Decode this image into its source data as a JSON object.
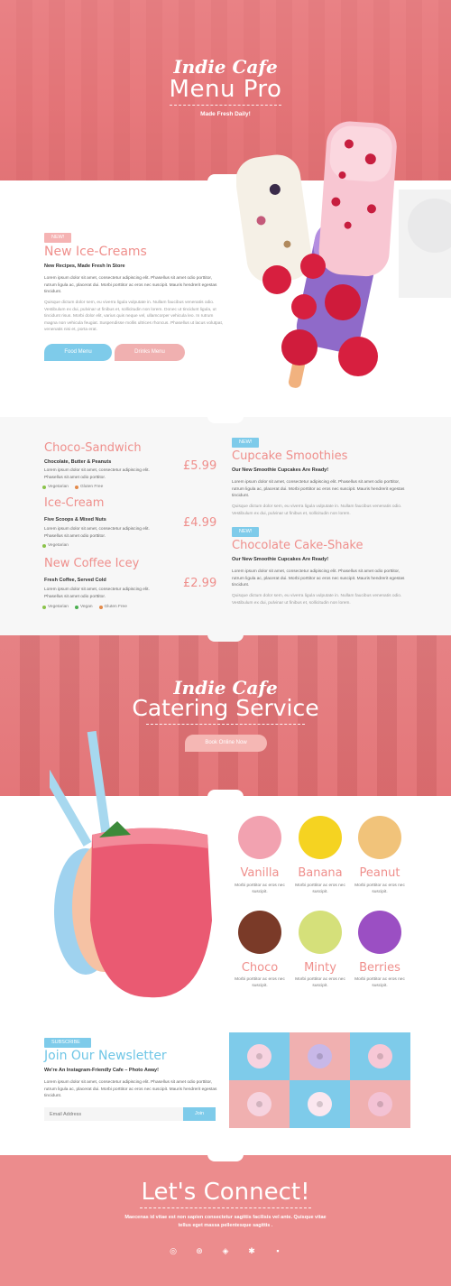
{
  "hero": {
    "script_title": "Indie Cafe",
    "title": "Menu Pro",
    "tagline": "Made Fresh Daily!"
  },
  "intro": {
    "badge": "NEW!",
    "heading": "New Ice-Creams",
    "subheading": "New Recipes, Made Fresh In Store",
    "para1": "Lorem ipsum dolor sit amet, consectetur adipiscing elit. Phasellus sit amet odio porttitor, rutrum ligula ac, placerat dui. Morbi porttitor ac eros nec suscipit. Mauris hendrerit egestas tincidunt.",
    "para2": "Quisque dictum dolor sem, eu viverra ligula vulputate in. Nullam faucibus venenatis odio. Vestibulum ex dui, pulvinar ut finibus et, sollicitudin non lorem. Donec ut tincidunt ligula, ut tincidunt risus. Morbi dolor elit, varius quis neque vel, ullamcorper vehicula leo. In rutrum magna non vehicula feugiat. Suspendisse mollis ultrices rhoncus. Phasellus ut lacus volutpat, venenatis nisi et, porta erat.",
    "btn_food": "Food Menu",
    "btn_drinks": "Drinks Menu"
  },
  "menu_left": [
    {
      "name": "Choco-Sandwich",
      "sub": "Chocolate, Butter & Peanuts",
      "desc": "Lorem ipsum dolor sit amet, consectetur adipiscing elit. Phasellus sit amet odio porttitor.",
      "price": "£5.99",
      "tags": [
        "Vegetarian",
        "Gluten Free"
      ]
    },
    {
      "name": "Ice-Cream",
      "sub": "Five Scoops & Mixed Nuts",
      "desc": "Lorem ipsum dolor sit amet, consectetur adipiscing elit. Phasellus sit amet odio porttitor.",
      "price": "£4.99",
      "tags": [
        "Vegetarian"
      ]
    },
    {
      "name": "New Coffee Icey",
      "sub": "Fresh Coffee, Served Cold",
      "desc": "Lorem ipsum dolor sit amet, consectetur adipiscing elit. Phasellus sit amet odio porttitor.",
      "price": "£2.99",
      "tags": [
        "Vegetarian",
        "Vegan",
        "Gluten Free"
      ]
    }
  ],
  "menu_right": [
    {
      "badge": "NEW!",
      "name": "Cupcake Smoothies",
      "sub": "Our New Smoothie Cupcakes Are Ready!",
      "para1": "Lorem ipsum dolor sit amet, consectetur adipiscing elit. Phasellus sit amet odio porttitor, rutrum ligula ac, placerat dui. Morbi porttitor ac eros nec suscipit. Mauris hendrerit egestas tincidunt.",
      "para2": "Quisque dictum dolor sem, eu viverra ligula vulputate in. Nullam faucibus venenatis odio. Vestibulum ex dui, pulvinar ut finibus et, sollicitudin non lorem."
    },
    {
      "badge": "NEW!",
      "name": "Chocolate Cake-Shake",
      "sub": "Our New Smoothie Cupcakes Are Ready!",
      "para1": "Lorem ipsum dolor sit amet, consectetur adipiscing elit. Phasellus sit amet odio porttitor, rutrum ligula ac, placerat dui. Morbi porttitor ac eros nec suscipit. Mauris hendrerit egestas tincidunt.",
      "para2": "Quisque dictum dolor sem, eu viverra ligula vulputate in. Nullam faucibus venenatis odio. Vestibulum ex dui, pulvinar ut finibus et, sollicitudin non lorem."
    }
  ],
  "catering": {
    "script_title": "Indie Cafe",
    "title": "Catering Service",
    "button": "Book Online Now"
  },
  "flavours": [
    {
      "name": "Vanilla",
      "desc": "Morbi porttitor ac eros nec suscipit.",
      "color": "#f2a2b0"
    },
    {
      "name": "Banana",
      "desc": "Morbi porttitor ac eros nec suscipit.",
      "color": "#f5d321"
    },
    {
      "name": "Peanut",
      "desc": "Morbi porttitor ac eros nec suscipit.",
      "color": "#f1c37a"
    },
    {
      "name": "Choco",
      "desc": "Morbi porttitor ac eros nec suscipit.",
      "color": "#7a3a28"
    },
    {
      "name": "Minty",
      "desc": "Morbi porttitor ac eros nec suscipit.",
      "color": "#d5e07a"
    },
    {
      "name": "Berries",
      "desc": "Morbi porttitor ac eros nec suscipit.",
      "color": "#9b4fc3"
    }
  ],
  "newsletter": {
    "badge": "SUBSCRIBE",
    "heading": "Join Our Newsletter",
    "subheading": "We're An Instagram-Friendly Cafe – Photo Away!",
    "para": "Lorem ipsum dolor sit amet, consectetur adipiscing elit. Phasellus sit amet odio porttitor, rutrum ligula ac, placerat dui. Morbi porttitor ac eros nec suscipit. Mauris hendrerit egestas tincidunt.",
    "email_placeholder": "Email Address",
    "join": "Join"
  },
  "footer": {
    "title": "Let's Connect!",
    "line1": "Maecenas id vitae  est non sapien consectetur sagittis facilisis vel ante. Quisque vitae",
    "line2": "tellus eget massa pellentesque sagittis .",
    "socials": [
      "instagram-icon",
      "pinterest-icon",
      "snapchat-icon",
      "yelp-icon",
      "flickr-icon"
    ]
  },
  "colors": {
    "coral": "#ef8f8c",
    "blue": "#6fc6e6",
    "pink_bg": "#e8777a"
  }
}
